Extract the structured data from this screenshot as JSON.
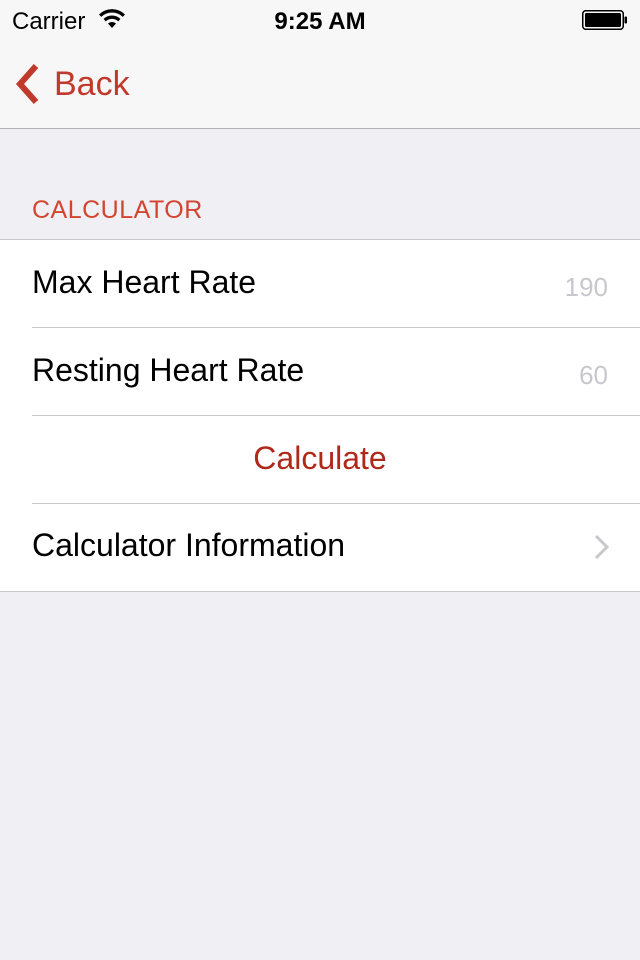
{
  "status": {
    "carrier": "Carrier",
    "time": "9:25 AM"
  },
  "nav": {
    "back_label": "Back"
  },
  "section": {
    "header": "CALCULATOR"
  },
  "rows": {
    "max_hr": {
      "label": "Max Heart Rate",
      "value": "190"
    },
    "resting_hr": {
      "label": "Resting Heart Rate",
      "value": "60"
    },
    "calculate": {
      "label": "Calculate"
    },
    "info": {
      "label": "Calculator Information"
    }
  },
  "colors": {
    "accent": "#c0392b",
    "section_header": "#d2452f",
    "placeholder": "#c7c7cd",
    "background": "#efeff4"
  },
  "icons": [
    "wifi-icon",
    "battery-icon",
    "back-chevron-icon",
    "disclosure-chevron-icon"
  ]
}
